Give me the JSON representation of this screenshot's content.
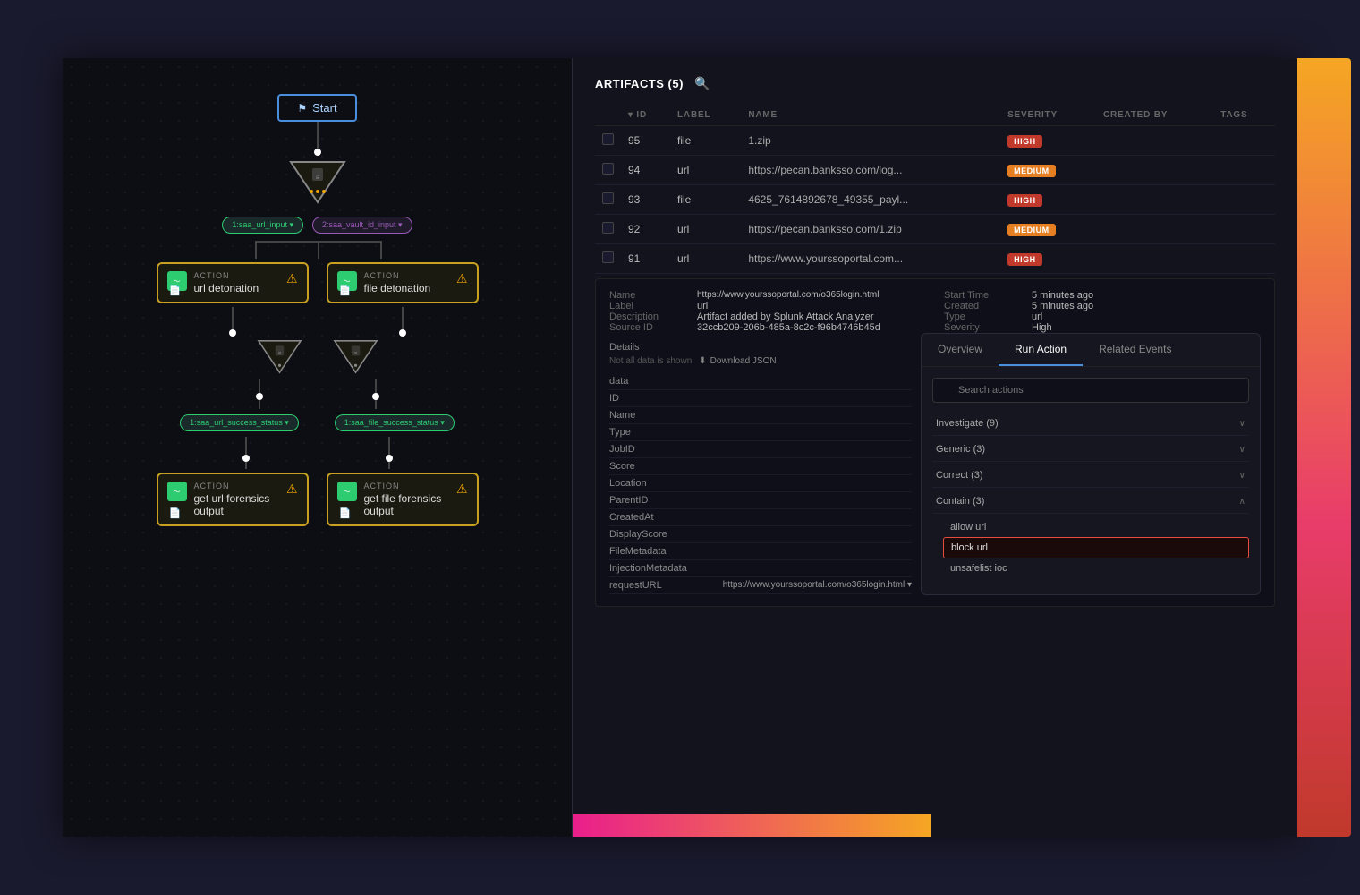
{
  "app": {
    "title": "Splunk Attack Analyzer"
  },
  "left_panel": {
    "start_node": "Start",
    "workflow": {
      "filter_node": "filter",
      "tags": [
        {
          "label": "1:saa_url_input ▾",
          "type": "green"
        },
        {
          "label": "2:saa_vault_id_input ▾",
          "type": "purple"
        }
      ],
      "actions": [
        {
          "label": "ACTION",
          "title": "url detonation",
          "type": "left"
        },
        {
          "label": "ACTION",
          "title": "file detonation",
          "type": "right"
        }
      ],
      "status_tags": [
        {
          "label": "1:saa_url_success_status ▾",
          "type": "green"
        },
        {
          "label": "1:saa_file_success_status ▾",
          "type": "green"
        }
      ],
      "forensics_actions": [
        {
          "label": "ACTION",
          "title": "get url forensics output"
        },
        {
          "label": "ACTION",
          "title": "get file forensics output"
        }
      ]
    }
  },
  "right_panel": {
    "artifacts_title": "ARTIFACTS (5)",
    "table": {
      "columns": [
        "",
        "▾ ID",
        "LABEL",
        "NAME",
        "SEVERITY",
        "CREATED BY",
        "TAGS"
      ],
      "rows": [
        {
          "id": "95",
          "label": "file",
          "name": "1.zip",
          "severity": "HIGH",
          "severity_type": "high"
        },
        {
          "id": "94",
          "label": "url",
          "name": "https://pecan.banksso.com/log...",
          "severity": "MEDIUM",
          "severity_type": "medium"
        },
        {
          "id": "93",
          "label": "file",
          "name": "4625_7614892678_49355_payl...",
          "severity": "HIGH",
          "severity_type": "high"
        },
        {
          "id": "92",
          "label": "url",
          "name": "https://pecan.banksso.com/1.zip",
          "severity": "MEDIUM",
          "severity_type": "medium"
        },
        {
          "id": "91",
          "label": "url",
          "name": "https://www.yourssoportal.com...",
          "severity": "HIGH",
          "severity_type": "high"
        }
      ]
    },
    "detail": {
      "fields_left": [
        {
          "label": "Name",
          "value": "https://www.yourssoportal.com/o365login.html"
        },
        {
          "label": "Label",
          "value": "url"
        },
        {
          "label": "Description",
          "value": "Artifact added by Splunk Attack Analyzer"
        },
        {
          "label": "Source ID",
          "value": "32ccb209-206b-485a-8c2c-f96b4746b45d"
        }
      ],
      "fields_right": [
        {
          "label": "Start Time",
          "value": "5 minutes ago"
        },
        {
          "label": "Created",
          "value": "5 minutes ago"
        },
        {
          "label": "Type",
          "value": "url"
        },
        {
          "label": "Severity",
          "value": "High"
        }
      ],
      "details_section": "Details",
      "details_note": "Not all data is shown",
      "download_link": "Download JSON",
      "data_fields": [
        {
          "label": "data"
        },
        {
          "label": "ID"
        },
        {
          "label": "Name"
        },
        {
          "label": "Type"
        },
        {
          "label": "JobID"
        },
        {
          "label": "Score"
        },
        {
          "label": "Location"
        },
        {
          "label": "ParentID"
        },
        {
          "label": "CreatedAt"
        },
        {
          "label": "DisplayScore"
        },
        {
          "label": "FileMetadata"
        },
        {
          "label": "InjectionMetadata"
        },
        {
          "label": "requestURL",
          "value": "https://www.yourssoportal.com/o365login.html ▾"
        }
      ]
    },
    "action_panel": {
      "tabs": [
        {
          "label": "Overview",
          "active": false
        },
        {
          "label": "Run Action",
          "active": true
        },
        {
          "label": "Related Events",
          "active": false
        }
      ],
      "search_placeholder": "Search actions",
      "groups": [
        {
          "label": "Investigate (9)",
          "expanded": false,
          "chevron": "∨"
        },
        {
          "label": "Generic (3)",
          "expanded": false,
          "chevron": "∨"
        },
        {
          "label": "Correct (3)",
          "expanded": false,
          "chevron": "∨"
        },
        {
          "label": "Contain (3)",
          "expanded": true,
          "chevron": "∧",
          "items": [
            {
              "label": "allow url",
              "selected": false
            },
            {
              "label": "block url",
              "selected": true
            },
            {
              "label": "unsafelist ioc",
              "selected": false
            }
          ]
        }
      ]
    }
  }
}
